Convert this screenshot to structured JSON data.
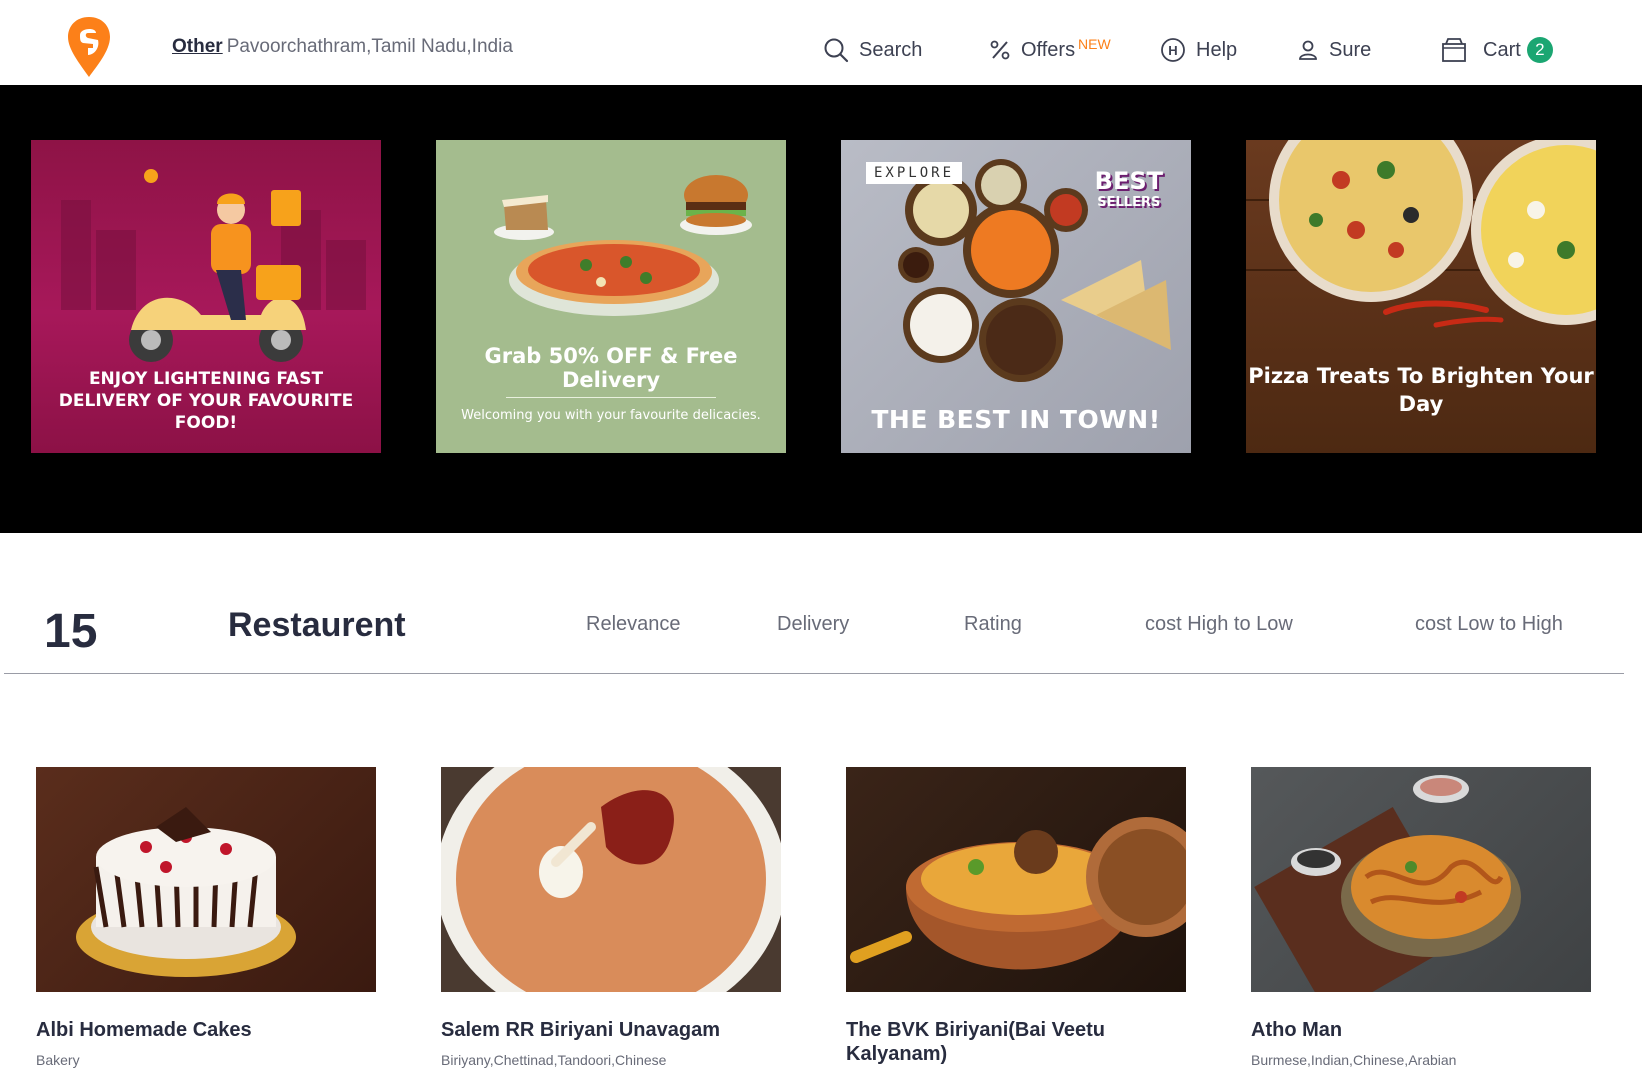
{
  "header": {
    "location_type": "Other",
    "location_address": "Pavoorchathram,Tamil Nadu,India",
    "nav": {
      "search": "Search",
      "offers": "Offers",
      "offers_badge": "NEW",
      "help": "Help",
      "user": "Sure",
      "cart": "Cart",
      "cart_count": "2"
    }
  },
  "banners": [
    {
      "text": "ENJOY LIGHTENING FAST DELIVERY OF YOUR FAVOURITE FOOD!"
    },
    {
      "text": "Grab 50% OFF & Free Delivery",
      "subtext": "Welcoming you with your favourite delicacies."
    },
    {
      "tag": "EXPLORE",
      "badge_big": "BEST",
      "badge_small": "SELLERS",
      "text": "THE BEST IN TOWN!"
    },
    {
      "text": "Pizza Treats To Brighten Your Day"
    }
  ],
  "listing": {
    "count": "15",
    "label": "Restaurent",
    "sort_options": [
      "Relevance",
      "Delivery",
      "Rating",
      "cost High to Low",
      "cost Low to High"
    ]
  },
  "restaurants": [
    {
      "name": "Albi Homemade Cakes",
      "cuisine": "Bakery"
    },
    {
      "name": "Salem RR Biriyani Unavagam",
      "cuisine": "Biriyany,Chettinad,Tandoori,Chinese"
    },
    {
      "name": "The BVK Biriyani(Bai Veetu Kalyanam)",
      "cuisine": ""
    },
    {
      "name": "Atho Man",
      "cuisine": "Burmese,Indian,Chinese,Arabian"
    }
  ],
  "colors": {
    "brand": "#fc8019",
    "cart_badge": "#1ba672",
    "banner_bg": "#000000"
  }
}
